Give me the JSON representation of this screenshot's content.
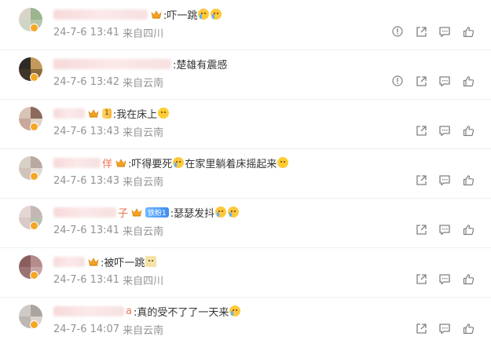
{
  "comments": [
    {
      "name_tail": "",
      "crown": true,
      "fan_badge": "",
      "text": ":吓一跳",
      "emojis": [
        "cry",
        "cry"
      ],
      "date": "24-7-6 13:41",
      "location": "来自四川",
      "actions": [
        "report",
        "share",
        "reply",
        "like"
      ],
      "avatar_colors": [
        "#d9d4c9",
        "#9bb58e",
        "#cfd7c4",
        "#b8c7a8"
      ]
    },
    {
      "name_tail": "",
      "crown": false,
      "fan_badge": "",
      "text": ":楚雄有震感",
      "emojis": [],
      "date": "24-7-6 13:42",
      "location": "来自云南",
      "actions": [
        "report",
        "share",
        "reply",
        "like"
      ],
      "avatar_colors": [
        "#2f2a25",
        "#c49a5c",
        "#403529",
        "#8e6b3d"
      ]
    },
    {
      "name_tail": "",
      "crown": true,
      "fan_badge": "1",
      "text": ":我在床上",
      "emojis": [
        "smile"
      ],
      "date": "24-7-6 13:43",
      "location": "来自云南",
      "actions": [
        "share",
        "reply",
        "like"
      ],
      "avatar_colors": [
        "#d9c2b6",
        "#8b6a5c",
        "#c7a89a",
        "#e2d2c8"
      ]
    },
    {
      "name_tail": "佯",
      "crown": true,
      "fan_badge": "",
      "text": ":吓得要死",
      "emojis": [
        "cry"
      ],
      "text_after": "在家里躺着床摇起来",
      "emojis_after": [
        "laugh"
      ],
      "date": "24-7-6 13:43",
      "location": "来自云南",
      "actions": [
        "share",
        "reply",
        "like"
      ],
      "avatar_colors": [
        "#d8cfc7",
        "#b9a9a0",
        "#cfc3ba",
        "#e3dad3"
      ]
    },
    {
      "name_tail": "子",
      "crown": true,
      "fan_badge": "铁粉1",
      "text": ":瑟瑟发抖",
      "emojis": [
        "cry",
        "cry"
      ],
      "date": "24-7-6 13:41",
      "location": "来自云南",
      "actions": [
        "share",
        "reply",
        "like"
      ],
      "avatar_colors": [
        "#e5d5d3",
        "#c4b8b5",
        "#d9c9c7",
        "#b7c1b0"
      ]
    },
    {
      "name_tail": "",
      "crown": true,
      "fan_badge": "",
      "text": ":被吓一跳",
      "emojis": [
        "card"
      ],
      "date": "24-7-6 13:41",
      "location": "来自四川",
      "actions": [
        "share",
        "reply",
        "like"
      ],
      "avatar_colors": [
        "#8a5e5e",
        "#b58b8b",
        "#9b7373",
        "#c7a3a3"
      ]
    },
    {
      "name_tail": "a",
      "crown": false,
      "fan_badge": "",
      "text": ":真的受不了了一天来",
      "emojis": [
        "cry"
      ],
      "date": "24-7-6 14:07",
      "location": "来自云南",
      "actions": [
        "share",
        "reply",
        "like"
      ],
      "avatar_colors": [
        "#cfcac6",
        "#a9a4a0",
        "#bdb8b3",
        "#d8d3cf"
      ]
    }
  ]
}
